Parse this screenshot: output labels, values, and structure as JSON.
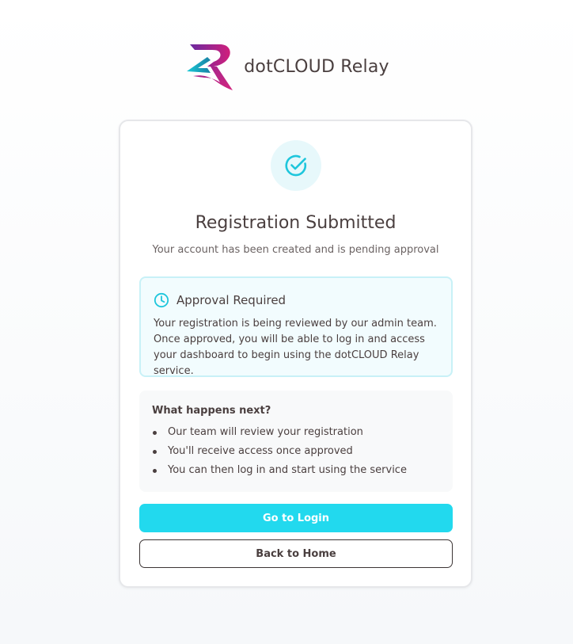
{
  "brand": {
    "name": "dotCLOUD Relay",
    "logo_icon": "r-logo-icon",
    "colors": {
      "teal": "#1fb4c6",
      "magenta": "#c0267a",
      "purple": "#6a2aa0"
    }
  },
  "card": {
    "status_icon": "check-circle-icon",
    "title": "Registration Submitted",
    "subtitle": "Your account has been created and is pending approval"
  },
  "notice": {
    "icon": "clock-icon",
    "title": "Approval Required",
    "body": "Your registration is being reviewed by our admin team. Once approved, you will be able to log in and access your dashboard to begin using the dotCLOUD Relay service."
  },
  "next_steps": {
    "title": "What happens next?",
    "items": [
      "Our team will review your registration",
      "You'll receive access once approved",
      "You can then log in and start using the service"
    ]
  },
  "actions": {
    "login_label": "Go to Login",
    "home_label": "Back to Home"
  },
  "colors": {
    "accent": "#22d9ee",
    "notice_bg": "#f2fcfe",
    "notice_border": "#c8f1f7",
    "text": "#4a3f3f"
  }
}
